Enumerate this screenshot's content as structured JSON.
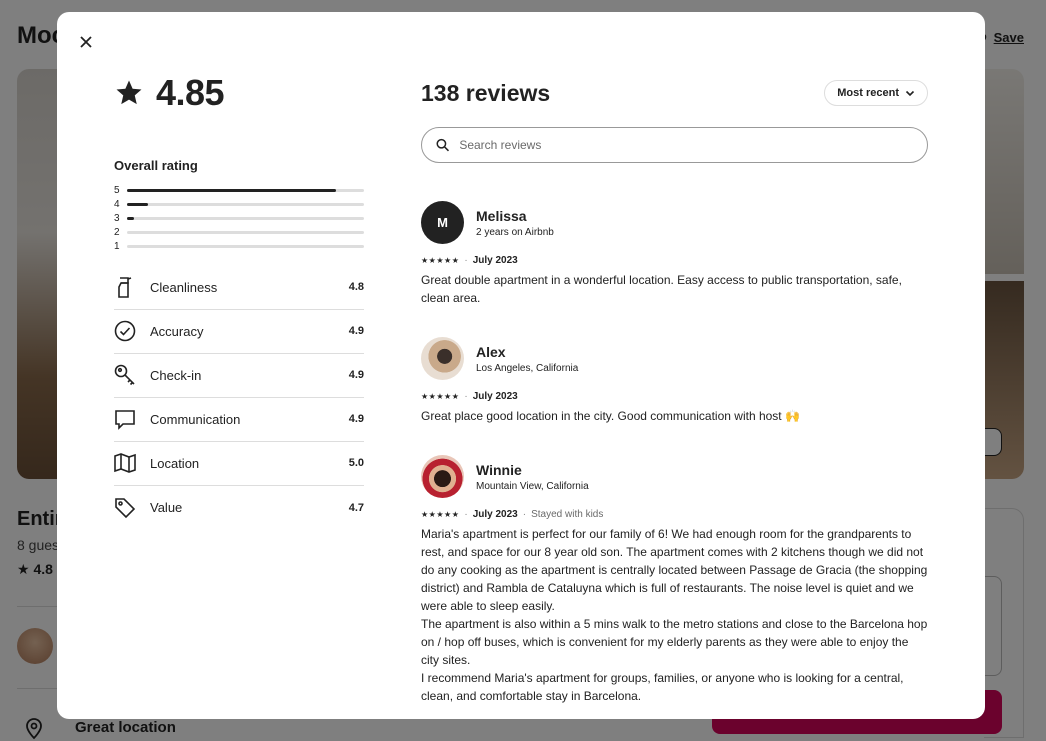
{
  "background": {
    "title": "Moc",
    "save_label": "Save",
    "entire_label": "Entir",
    "guests_label": "8 gues",
    "rating_label": "4.8",
    "great_location": "Great location"
  },
  "modal": {
    "overall_score": "4.85",
    "overall_label": "Overall rating",
    "distribution": [
      {
        "label": "5",
        "fraction": 0.88
      },
      {
        "label": "4",
        "fraction": 0.09
      },
      {
        "label": "3",
        "fraction": 0.03
      },
      {
        "label": "2",
        "fraction": 0.0
      },
      {
        "label": "1",
        "fraction": 0.0
      }
    ],
    "categories": [
      {
        "name": "Cleanliness",
        "value": "4.8",
        "icon": "spray-bottle-icon"
      },
      {
        "name": "Accuracy",
        "value": "4.9",
        "icon": "check-circle-icon"
      },
      {
        "name": "Check-in",
        "value": "4.9",
        "icon": "key-icon"
      },
      {
        "name": "Communication",
        "value": "4.9",
        "icon": "chat-bubble-icon"
      },
      {
        "name": "Location",
        "value": "5.0",
        "icon": "map-icon"
      },
      {
        "name": "Value",
        "value": "4.7",
        "icon": "tag-icon"
      }
    ],
    "reviews_count": "138 reviews",
    "sort_label": "Most recent",
    "search_placeholder": "Search reviews",
    "stars": "★★★★★",
    "reviews": [
      {
        "initial": "M",
        "name": "Melissa",
        "subtitle": "2 years on Airbnb",
        "date": "July 2023",
        "extra": "",
        "text": "Great double apartment in a wonderful location. Easy access to public transportation, safe, clean area."
      },
      {
        "initial": "",
        "name": "Alex",
        "subtitle": "Los Angeles, California",
        "date": "July 2023",
        "extra": "",
        "text": "Great place good location in the city. Good communication with host 🙌"
      },
      {
        "initial": "",
        "name": "Winnie",
        "subtitle": "Mountain View, California",
        "date": "July 2023",
        "extra": "Stayed with kids",
        "text": "Maria's apartment is perfect for our family of 6! We had enough room for the grandparents to rest, and space for our 8 year old son. The apartment comes with 2 kitchens though we did not do any cooking as the apartment is centrally located between Passage de Gracia (the shopping district) and Rambla de Cataluyna which is full of restaurants. The noise level is quiet and we were able to sleep easily.\nThe apartment is also within a 5 mins walk to the metro stations and close to the Barcelona hop on / hop off buses, which is convenient for my elderly parents as they were able to enjoy the city sites.\nI recommend Maria's apartment for groups, families, or anyone who is looking for a central, clean, and comfortable stay in Barcelona."
      }
    ]
  }
}
